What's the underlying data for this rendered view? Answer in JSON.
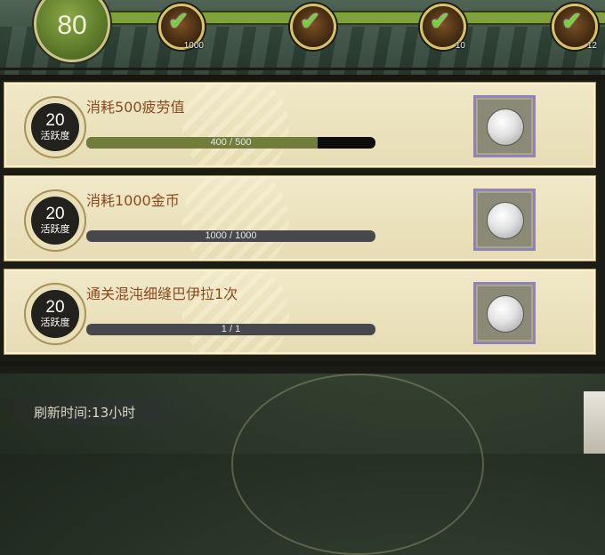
{
  "header": {
    "activity_total": "80",
    "milestones": [
      {
        "icon": "coin-chest-icon",
        "count": "1000"
      },
      {
        "icon": "red-gem-icon",
        "count": ""
      },
      {
        "icon": "wand-icon",
        "count": "10"
      },
      {
        "icon": "lotus-icon",
        "count": "12"
      }
    ]
  },
  "tasks": [
    {
      "points": "20",
      "points_label": "活跃度",
      "title": "消耗500疲劳值",
      "progress_text": "400 / 500",
      "progress": 0.8,
      "reward_icon": "silver-orb-icon"
    },
    {
      "points": "20",
      "points_label": "活跃度",
      "title": "消耗1000金币",
      "progress_text": "1000 / 1000",
      "progress": 1.0,
      "reward_icon": "silver-orb-icon"
    },
    {
      "points": "20",
      "points_label": "活跃度",
      "title": "通关混沌细缝巴伊拉1次",
      "progress_text": "1 / 1",
      "progress": 1.0,
      "reward_icon": "silver-orb-icon"
    }
  ],
  "footer": {
    "refresh_text": "刷新时间:13小时"
  },
  "colors": {
    "progress_fill": "#6f7e3a",
    "title_text": "#8a4a1f",
    "track_green": "#7fa23a"
  }
}
